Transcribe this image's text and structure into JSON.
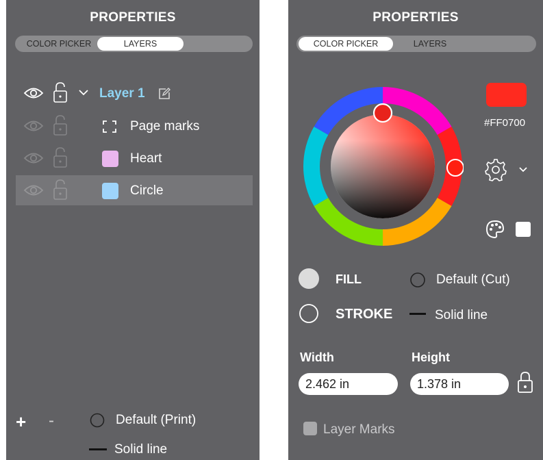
{
  "left_panel": {
    "title": "PROPERTIES",
    "tabs": [
      {
        "label": "COLOR PICKER",
        "active": false
      },
      {
        "label": "LAYERS",
        "active": true
      }
    ],
    "layers": [
      {
        "label": "Layer 1",
        "type": "group",
        "expanded": true,
        "color": "#8fd4f3"
      },
      {
        "label": "Page marks",
        "type": "page-marks"
      },
      {
        "label": "Heart",
        "type": "shape",
        "swatch": "#eab6ee"
      },
      {
        "label": "Circle",
        "type": "shape",
        "swatch": "#9ed4fb",
        "selected": true
      }
    ],
    "footer": {
      "add": "+",
      "remove": "-",
      "fill_mode": "Default (Print)",
      "stroke_mode": "Solid line"
    }
  },
  "right_panel": {
    "title": "PROPERTIES",
    "tabs": [
      {
        "label": "COLOR PICKER",
        "active": true
      },
      {
        "label": "LAYERS",
        "active": false
      }
    ],
    "color": {
      "hex_label": "#FF0700",
      "value": "#ff2a1f"
    },
    "fill": {
      "label": "FILL",
      "mode": "Default (Cut)"
    },
    "stroke": {
      "label": "STROKE",
      "mode": "Solid line"
    },
    "width": {
      "label": "Width",
      "value": "2.462 in"
    },
    "height": {
      "label": "Height",
      "value": "1.378 in"
    },
    "layer_marks": {
      "label": "Layer Marks",
      "checked": false
    }
  }
}
